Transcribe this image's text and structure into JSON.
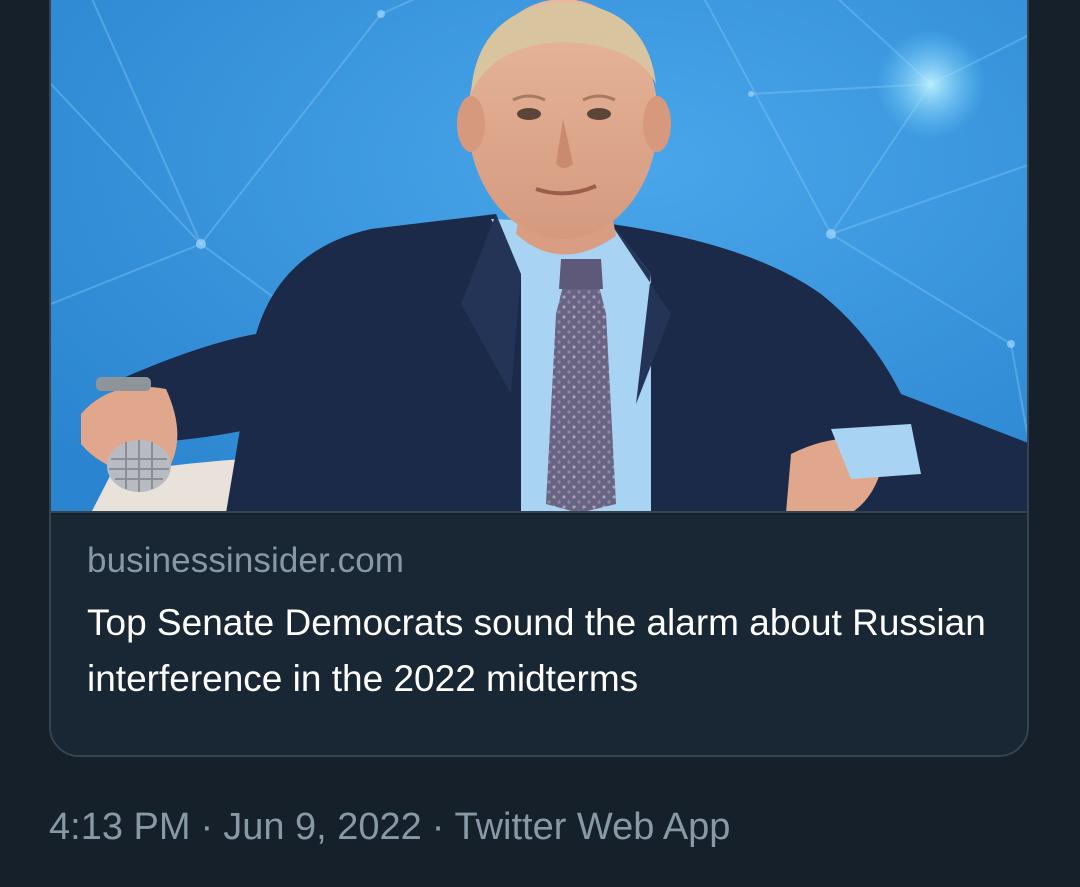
{
  "link_card": {
    "image": {
      "kind": "photo",
      "subject": "man in suit seated holding microphone",
      "background_color": "#2f8fd8",
      "suit_color": "#1b2a48",
      "shirt_color": "#a9d3f2",
      "tie_color": "#6a6483"
    },
    "domain": "businessinsider.com",
    "title": "Top Senate Democrats sound the alarm about Russian interference in the 2022 midterms"
  },
  "tweet_meta": {
    "time": "4:13 PM",
    "separator": "·",
    "date": "Jun 9, 2022",
    "source": "Twitter Web App"
  }
}
